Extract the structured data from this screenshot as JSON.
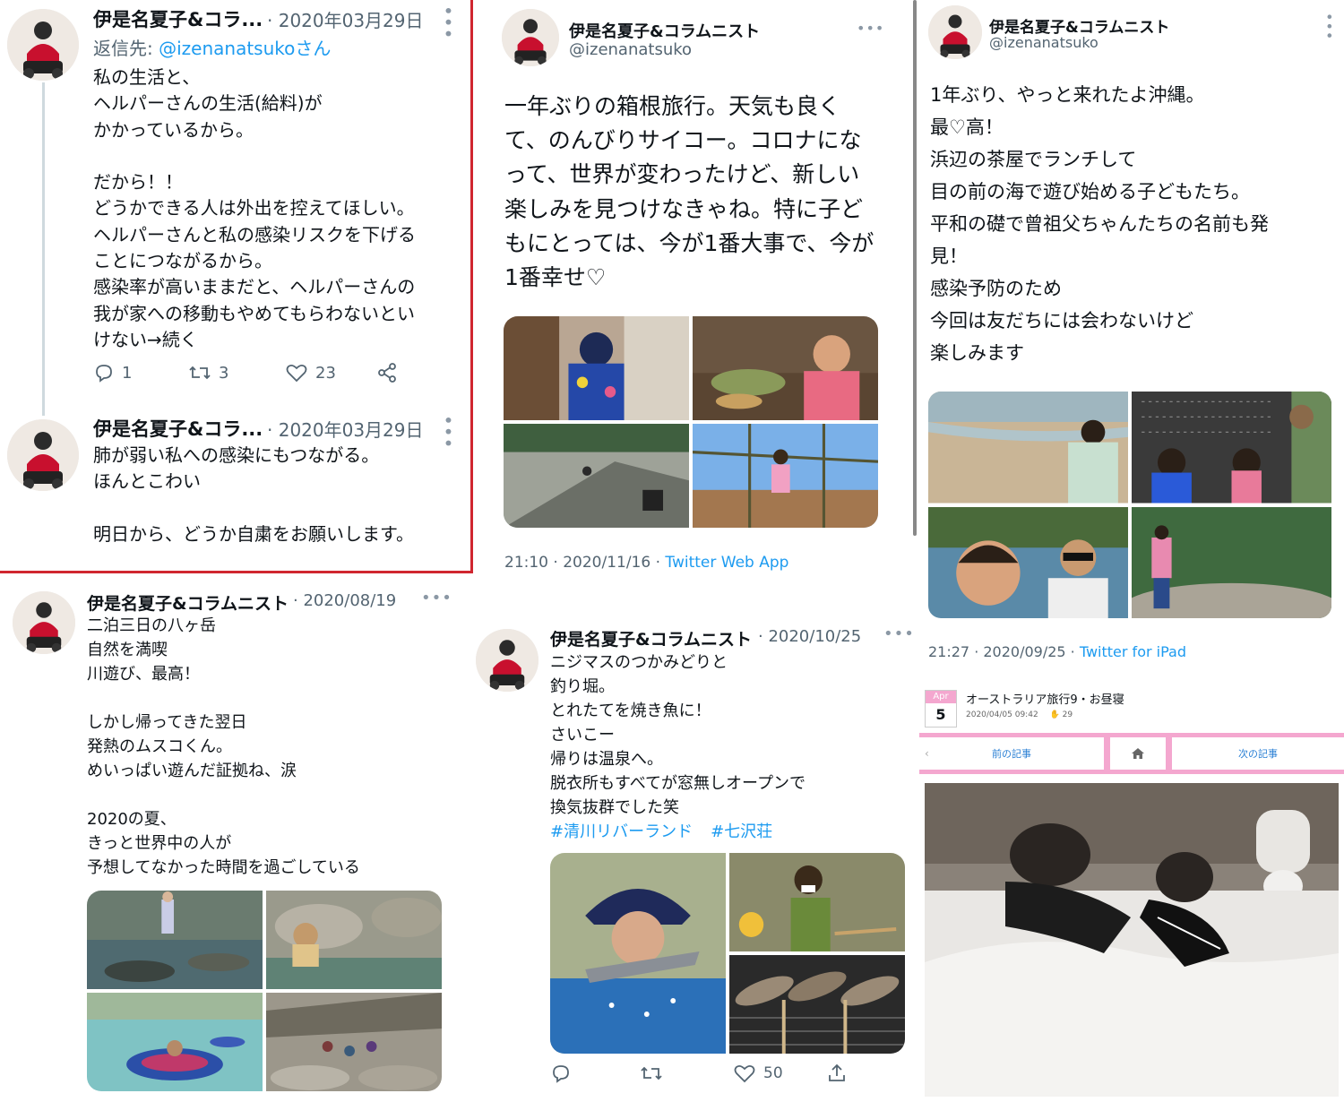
{
  "colors": {
    "accent": "#1d9bf0",
    "highlight_border": "#d0262f",
    "blog_pink": "#f4a7cf"
  },
  "tweet_a": {
    "author": "伊是名夏子&コラ...",
    "date": "· 2020年03月29日",
    "reply_to_prefix": "返信先: ",
    "reply_to_handle": "@izenanatsukoさん",
    "text": "私の生活と、\nヘルパーさんの生活(給料)が\nかかっているから。\n\nだから！！\nどうかできる人は外出を控えてほしい。\nヘルパーさんと私の感染リスクを下げる\nことにつながるから。\n感染率が高いままだと、ヘルパーさんの\n我が家への移動もやめてもらわないとい\nけない→続く",
    "replies": "1",
    "retweets": "3",
    "likes": "23"
  },
  "tweet_b": {
    "author": "伊是名夏子&コラ...",
    "date": "· 2020年03月29日",
    "text": "肺が弱い私への感染にもつながる。\nほんとこわい\n\n明日から、どうか自粛をお願いします。"
  },
  "tweet_c": {
    "author": "伊是名夏子&コラムニスト",
    "date": "· 2020/08/19",
    "text": "二泊三日の八ヶ岳\n自然を満喫\n川遊び、最高！\n\nしかし帰ってきた翌日\n発熱のムスコくん。\nめいっぱい遊んだ証拠ね、涙\n\n2020の夏、\nきっと世界中の人が\n予想してなかった時間を過ごしている"
  },
  "tweet_d": {
    "author": "伊是名夏子&コラムニスト",
    "handle": "@izenanatsuko",
    "text": "一年ぶりの箱根旅行。天気も良く\nて、のんびりサイコー。コロナにな\nって、世界が変わったけど、新しい\n楽しみを見つけなきゃね。特に子ど\nもにとっては、今が1番大事で、今が\n1番幸せ♡",
    "timestamp": "21:10 · 2020/11/16 · ",
    "source": "Twitter Web App"
  },
  "tweet_e": {
    "author": "伊是名夏子&コラムニスト",
    "date": "· 2020/10/25",
    "text": "ニジマスのつかみどりと\n釣り堀。\nとれたてを焼き魚に！\nさいこー\n帰りは温泉へ。\n脱衣所もすべてが窓無しオープンで\n換気抜群でした笑",
    "hashtag1": "#清川リバーランド",
    "hashtag2": "#七沢荘",
    "likes": "50"
  },
  "tweet_f": {
    "author": "伊是名夏子&コラムニスト",
    "handle": "@izenanatsuko",
    "text": "1年ぶり、やっと来れたよ沖縄。\n最♡高！\n浜辺の茶屋でランチして\n目の前の海で遊び始める子どもたち。\n平和の礎で曾祖父ちゃんたちの名前も発\n見！\n感染予防のため\n今回は友だちには会わないけど\n楽しみます",
    "timestamp": "21:27 · 2020/09/25 · ",
    "source": "Twitter for iPad"
  },
  "blog": {
    "month": "Apr",
    "day": "5",
    "title": "オーストラリア旅行9・お昼寝",
    "datetime": "2020/04/05 09:42",
    "claps": "29",
    "prev_label": "前の記事",
    "next_label": "次の記事"
  }
}
